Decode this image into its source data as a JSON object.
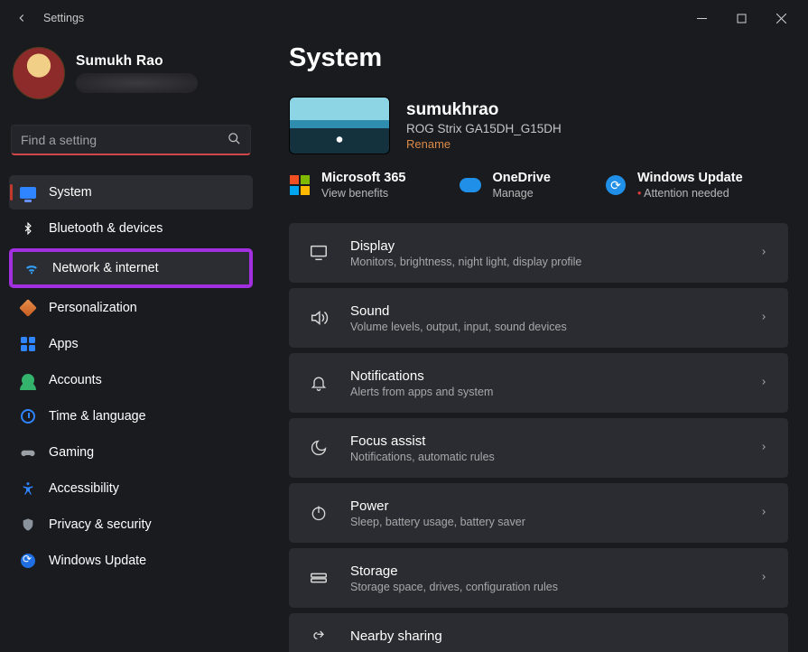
{
  "window": {
    "title": "Settings"
  },
  "user": {
    "name": "Sumukh Rao"
  },
  "search": {
    "placeholder": "Find a setting"
  },
  "sidebar": {
    "items": [
      {
        "label": "System"
      },
      {
        "label": "Bluetooth & devices"
      },
      {
        "label": "Network & internet"
      },
      {
        "label": "Personalization"
      },
      {
        "label": "Apps"
      },
      {
        "label": "Accounts"
      },
      {
        "label": "Time & language"
      },
      {
        "label": "Gaming"
      },
      {
        "label": "Accessibility"
      },
      {
        "label": "Privacy & security"
      },
      {
        "label": "Windows Update"
      }
    ]
  },
  "page": {
    "heading": "System",
    "device": {
      "name": "sumukhrao",
      "model": "ROG Strix GA15DH_G15DH",
      "rename": "Rename"
    },
    "services": [
      {
        "title": "Microsoft 365",
        "sub": "View benefits"
      },
      {
        "title": "OneDrive",
        "sub": "Manage"
      },
      {
        "title": "Windows Update",
        "sub": "Attention needed",
        "alert": true
      }
    ],
    "cards": [
      {
        "title": "Display",
        "desc": "Monitors, brightness, night light, display profile"
      },
      {
        "title": "Sound",
        "desc": "Volume levels, output, input, sound devices"
      },
      {
        "title": "Notifications",
        "desc": "Alerts from apps and system"
      },
      {
        "title": "Focus assist",
        "desc": "Notifications, automatic rules"
      },
      {
        "title": "Power",
        "desc": "Sleep, battery usage, battery saver"
      },
      {
        "title": "Storage",
        "desc": "Storage space, drives, configuration rules"
      },
      {
        "title": "Nearby sharing",
        "desc": ""
      }
    ]
  }
}
